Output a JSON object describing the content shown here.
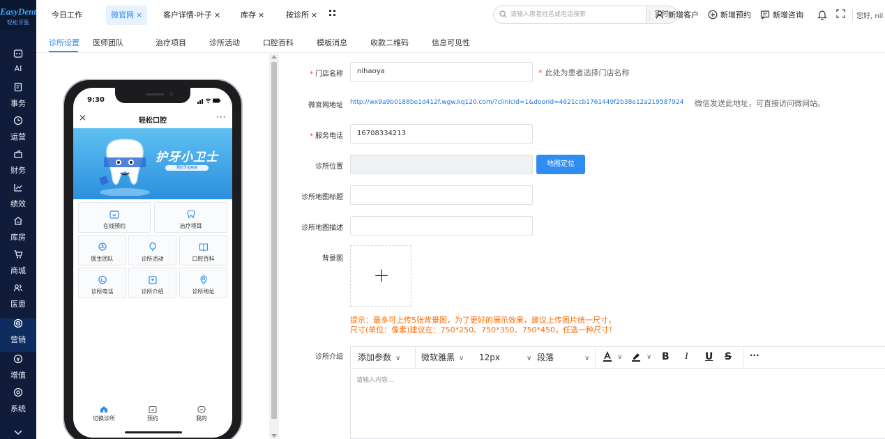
{
  "brand": {
    "name": "EasyDent",
    "sub": "轻松牙医"
  },
  "sidebar": {
    "items": [
      {
        "label": "AI",
        "icon": "ai-icon"
      },
      {
        "label": "事务",
        "icon": "clipboard-icon"
      },
      {
        "label": "运营",
        "icon": "clock-icon"
      },
      {
        "label": "财务",
        "icon": "wallet-icon"
      },
      {
        "label": "绩效",
        "icon": "chart-line-icon"
      },
      {
        "label": "库房",
        "icon": "warehouse-icon"
      },
      {
        "label": "商城",
        "icon": "cart-icon"
      },
      {
        "label": "医患",
        "icon": "users-icon"
      },
      {
        "label": "营销",
        "icon": "target-icon",
        "active": true
      },
      {
        "label": "增值",
        "icon": "coin-icon"
      },
      {
        "label": "系统",
        "icon": "settings-icon"
      }
    ],
    "more_icon": "chevron-down-icon"
  },
  "header": {
    "tabs": [
      {
        "label": "今日工作",
        "closable": false
      },
      {
        "label": "微官网",
        "closable": true,
        "active": true
      },
      {
        "label": "客户详情-叶子",
        "closable": true
      },
      {
        "label": "库存",
        "closable": true
      },
      {
        "label": "按诊所",
        "closable": true
      }
    ],
    "close_glyph": "×",
    "search": {
      "placeholder": "请输入患者姓名或电话搜索",
      "button": "实时"
    },
    "actions": {
      "new_customer": "新增客户",
      "new_appointment": "新增预约",
      "new_consult": "新增咨询"
    },
    "greeting": "您好, nil"
  },
  "subnav": {
    "tabs": [
      "诊所设置",
      "医师团队",
      "治疗项目",
      "诊所活动",
      "口腔百科",
      "模板消息",
      "收款二维码",
      "信息可见性"
    ],
    "active": 0
  },
  "phone": {
    "time": "9:30",
    "title": "轻松口腔",
    "close": "×",
    "more": "···",
    "banner": {
      "title": "护牙小卫士",
      "subtitle": "预防牙齿疾病"
    },
    "grid": [
      {
        "label": "在线预约",
        "icon": "calendar-icon"
      },
      {
        "label": "治疗项目",
        "icon": "tooth-icon"
      },
      {
        "label": "医生团队",
        "icon": "doctor-icon"
      },
      {
        "label": "诊所活动",
        "icon": "balloon-icon"
      },
      {
        "label": "口腔百科",
        "icon": "book-icon"
      },
      {
        "label": "诊所电话",
        "icon": "phone-icon"
      },
      {
        "label": "诊所介绍",
        "icon": "clinic-icon"
      },
      {
        "label": "诊所地址",
        "icon": "location-icon"
      }
    ],
    "bottom_nav": [
      {
        "label": "切换诊所",
        "icon": "home-icon"
      },
      {
        "label": "预约",
        "icon": "calendar-check-icon"
      },
      {
        "label": "我的",
        "icon": "chat-icon"
      }
    ]
  },
  "form": {
    "store_name": {
      "label": "门店名称",
      "value": "nihaoya",
      "note": "此处为患者选择门店名称"
    },
    "site_url": {
      "label": "微官网地址",
      "url": "http://wx9a9b0188be1d412f.wgw.kq120.com/?clinicId=1&doorId=4621ccb1761449f2b38e12a219587924",
      "note": "微信发送此地址，可直接访问微网站。"
    },
    "phone": {
      "label": "服务电话",
      "value": "16708334213"
    },
    "location": {
      "label": "诊所位置",
      "value": "",
      "button": "地图定位"
    },
    "map_title": {
      "label": "诊所地图标题",
      "value": ""
    },
    "map_desc": {
      "label": "诊所地图描述",
      "value": ""
    },
    "background": {
      "label": "背景图",
      "plus": "+"
    },
    "tip_line1": "提示：最多可上传5张背景图，为了更好的展示效果，建议上传图片统一尺寸，",
    "tip_line2": "尺寸(单位：像素)建议在：750*250、750*350、750*450，任选一种尺寸！",
    "intro": {
      "label": "诊所介绍",
      "toolbar": {
        "params": "添加参数",
        "font": "微软雅黑",
        "size": "12px",
        "para": "段落",
        "dropdown": "∨",
        "bold": "B",
        "italic": "I",
        "underline": "U",
        "strike": "S",
        "more": "···"
      },
      "placeholder": "请输入内容..."
    }
  },
  "colors": {
    "accent": "#2f8cf0",
    "sidebar": "#101c3a",
    "warning": "#ff6a00",
    "required": "#f04134"
  }
}
